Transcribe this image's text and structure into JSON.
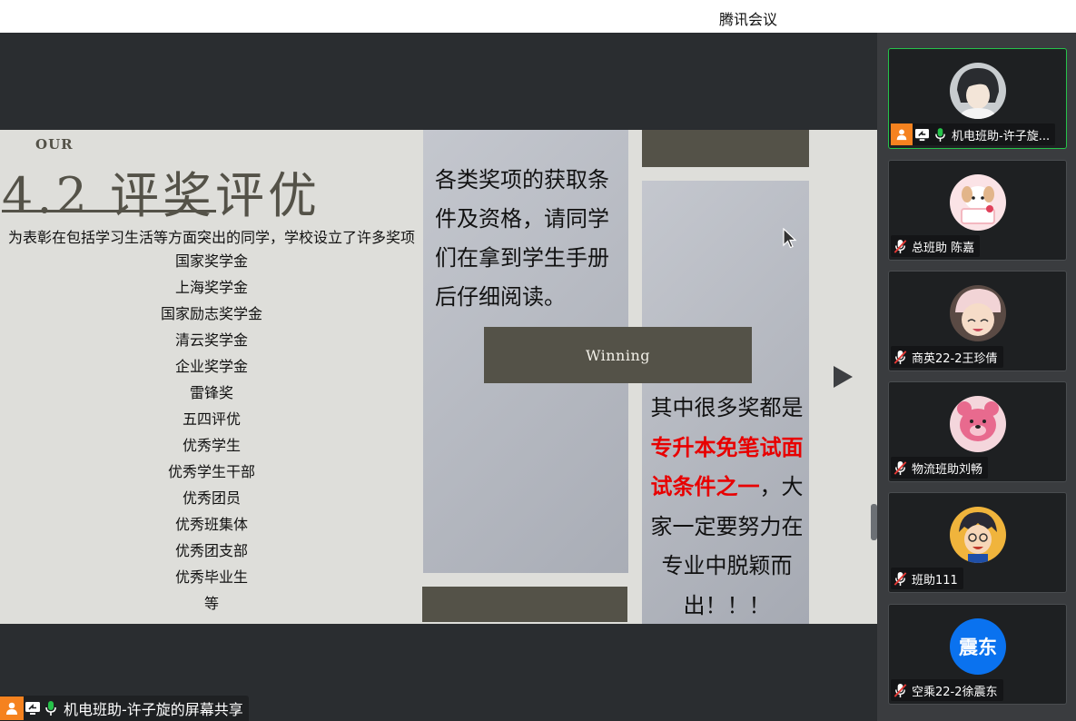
{
  "app": {
    "title": "腾讯会议"
  },
  "slide": {
    "overline": "OUR",
    "title": "4.2 评奖评优",
    "intro": "为表彰在包括学习生活等方面突出的同学，学校设立了许多奖项",
    "awards": [
      "国家奖学金",
      "上海奖学金",
      "国家励志奖学金",
      "清云奖学金",
      "企业奖学金",
      "雷锋奖",
      "五四评优",
      "优秀学生",
      "优秀学生干部",
      "优秀团员",
      "优秀班集体",
      "优秀团支部",
      "优秀毕业生",
      "等"
    ],
    "paragraph1": "各类奖项的获取条件及资格，请同学们在拿到学生手册后仔细阅读。",
    "winning_label": "Winning",
    "paragraph2_before": "其中很多奖都是",
    "paragraph2_highlight": "专升本免笔试面试条件之一",
    "paragraph2_after": "，大家一定要努力在专业中脱颖而出！！！",
    "highlight_color": "#e80000"
  },
  "share_label": {
    "text": "机电班助-许子旋的屏幕共享"
  },
  "participants": [
    {
      "name": "机电班助-许子旋...",
      "avatar": "anime-boy-avatar",
      "muted": false,
      "sharing": true,
      "active": true
    },
    {
      "name": "总班助 陈嘉",
      "avatar": "dog-cake-avatar",
      "muted": true
    },
    {
      "name": "商英22-2王珍倩",
      "avatar": "girl-photo-avatar",
      "muted": true
    },
    {
      "name": "物流班助刘畅",
      "avatar": "pink-bear-avatar",
      "muted": true
    },
    {
      "name": "班助111",
      "avatar": "conan-avatar",
      "muted": true
    },
    {
      "name": "空乘22-2徐震东",
      "avatar_text": "震东",
      "muted": true
    }
  ],
  "colors": {
    "accent_active": "#26c24a",
    "user_badge": "#f5821f",
    "avatar_blue": "#0a72ef",
    "slide_dark": "#545248"
  }
}
